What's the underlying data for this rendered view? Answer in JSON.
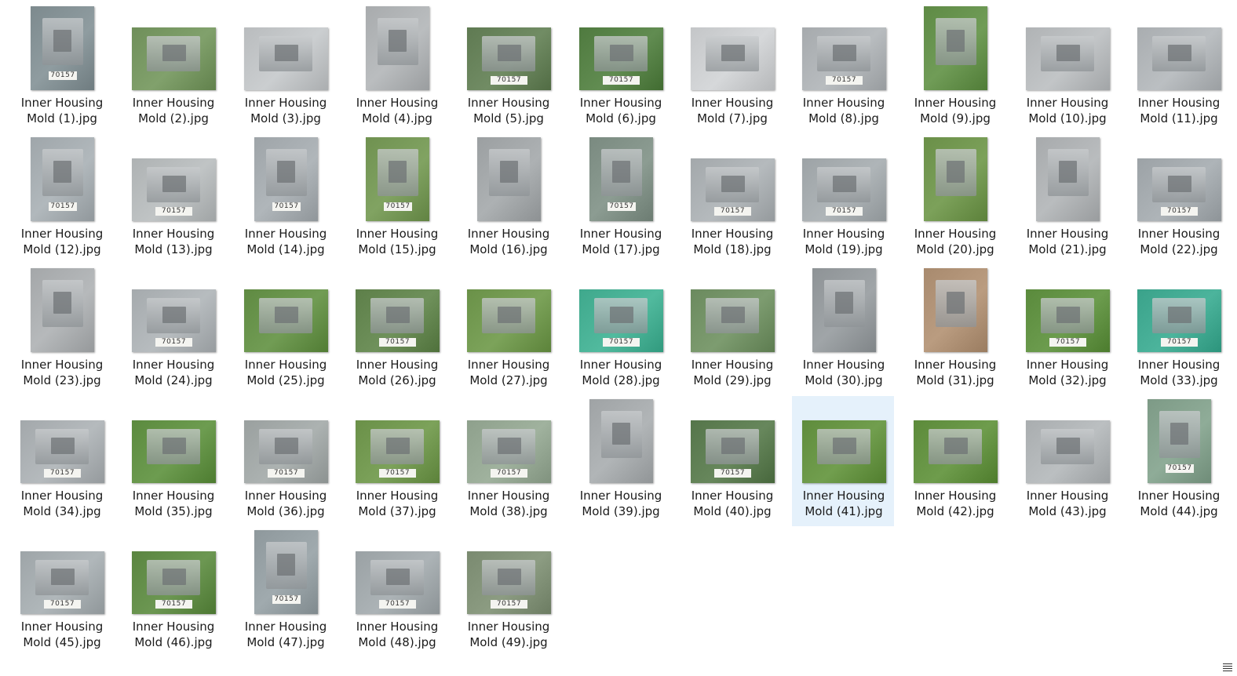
{
  "files": [
    {
      "line1": "Inner Housing",
      "line2": "Mold (1).jpg",
      "kind": "portrait",
      "bg": "#7d8a8e",
      "tag": "70157"
    },
    {
      "line1": "Inner Housing",
      "line2": "Mold (2).jpg",
      "kind": "landscape",
      "bg": "#6f8f5a",
      "tag": ""
    },
    {
      "line1": "Inner Housing",
      "line2": "Mold (3).jpg",
      "kind": "landscape",
      "bg": "#b9bcbe",
      "tag": ""
    },
    {
      "line1": "Inner Housing",
      "line2": "Mold (4).jpg",
      "kind": "portrait",
      "bg": "#a8abad",
      "tag": ""
    },
    {
      "line1": "Inner Housing",
      "line2": "Mold (5).jpg",
      "kind": "landscape",
      "bg": "#5f7a52",
      "tag": "70157"
    },
    {
      "line1": "Inner Housing",
      "line2": "Mold (6).jpg",
      "kind": "landscape",
      "bg": "#4f7a3f",
      "tag": "70157"
    },
    {
      "line1": "Inner Housing",
      "line2": "Mold (7).jpg",
      "kind": "landscape",
      "bg": "#c4c6c8",
      "tag": ""
    },
    {
      "line1": "Inner Housing",
      "line2": "Mold (8).jpg",
      "kind": "landscape",
      "bg": "#a6aaad",
      "tag": "70157"
    },
    {
      "line1": "Inner Housing",
      "line2": "Mold (9).jpg",
      "kind": "portrait",
      "bg": "#5e8a45",
      "tag": ""
    },
    {
      "line1": "Inner Housing",
      "line2": "Mold (10).jpg",
      "kind": "landscape",
      "bg": "#b0b3b5",
      "tag": ""
    },
    {
      "line1": "Inner Housing",
      "line2": "Mold (11).jpg",
      "kind": "landscape",
      "bg": "#a9adb0",
      "tag": ""
    },
    {
      "line1": "Inner Housing",
      "line2": "Mold (12).jpg",
      "kind": "portrait",
      "bg": "#9fa6aa",
      "tag": "70157"
    },
    {
      "line1": "Inner Housing",
      "line2": "Mold (13).jpg",
      "kind": "landscape",
      "bg": "#aeb2b3",
      "tag": "70157"
    },
    {
      "line1": "Inner Housing",
      "line2": "Mold (14).jpg",
      "kind": "portrait",
      "bg": "#9ea4a8",
      "tag": "70157"
    },
    {
      "line1": "Inner Housing",
      "line2": "Mold (15).jpg",
      "kind": "portrait",
      "bg": "#6f9150",
      "tag": "70157"
    },
    {
      "line1": "Inner Housing",
      "line2": "Mold (16).jpg",
      "kind": "portrait",
      "bg": "#9b9fa1",
      "tag": ""
    },
    {
      "line1": "Inner Housing",
      "line2": "Mold (17).jpg",
      "kind": "portrait",
      "bg": "#7a8a80",
      "tag": "70157"
    },
    {
      "line1": "Inner Housing",
      "line2": "Mold (18).jpg",
      "kind": "landscape",
      "bg": "#a3a8ab",
      "tag": "70157"
    },
    {
      "line1": "Inner Housing",
      "line2": "Mold (19).jpg",
      "kind": "landscape",
      "bg": "#9da3a6",
      "tag": "70157"
    },
    {
      "line1": "Inner Housing",
      "line2": "Mold (20).jpg",
      "kind": "portrait",
      "bg": "#6a8f48",
      "tag": ""
    },
    {
      "line1": "Inner Housing",
      "line2": "Mold (21).jpg",
      "kind": "portrait",
      "bg": "#a7aaac",
      "tag": ""
    },
    {
      "line1": "Inner Housing",
      "line2": "Mold (22).jpg",
      "kind": "landscape",
      "bg": "#9ca2a6",
      "tag": "70157"
    },
    {
      "line1": "Inner Housing",
      "line2": "Mold (23).jpg",
      "kind": "portrait",
      "bg": "#a4a7a9",
      "tag": ""
    },
    {
      "line1": "Inner Housing",
      "line2": "Mold (24).jpg",
      "kind": "landscape",
      "bg": "#a5aaad",
      "tag": "70157"
    },
    {
      "line1": "Inner Housing",
      "line2": "Mold (25).jpg",
      "kind": "landscape",
      "bg": "#5f8a42",
      "tag": ""
    },
    {
      "line1": "Inner Housing",
      "line2": "Mold (26).jpg",
      "kind": "landscape",
      "bg": "#5d7f49",
      "tag": "70157"
    },
    {
      "line1": "Inner Housing",
      "line2": "Mold (27).jpg",
      "kind": "landscape",
      "bg": "#6a9148",
      "tag": ""
    },
    {
      "line1": "Inner Housing",
      "line2": "Mold (28).jpg",
      "kind": "landscape",
      "bg": "#3fa88c",
      "tag": "70157"
    },
    {
      "line1": "Inner Housing",
      "line2": "Mold (29).jpg",
      "kind": "landscape",
      "bg": "#6b8a5e",
      "tag": ""
    },
    {
      "line1": "Inner Housing",
      "line2": "Mold (30).jpg",
      "kind": "portrait",
      "bg": "#8e9396",
      "tag": ""
    },
    {
      "line1": "Inner Housing",
      "line2": "Mold (31).jpg",
      "kind": "portrait",
      "bg": "#a88a6e",
      "tag": ""
    },
    {
      "line1": "Inner Housing",
      "line2": "Mold (32).jpg",
      "kind": "landscape",
      "bg": "#5a8a3c",
      "tag": "70157"
    },
    {
      "line1": "Inner Housing",
      "line2": "Mold (33).jpg",
      "kind": "landscape",
      "bg": "#3aa28a",
      "tag": "70157"
    },
    {
      "line1": "Inner Housing",
      "line2": "Mold (34).jpg",
      "kind": "landscape",
      "bg": "#a3a8ab",
      "tag": "70157"
    },
    {
      "line1": "Inner Housing",
      "line2": "Mold (35).jpg",
      "kind": "landscape",
      "bg": "#5b8a3e",
      "tag": ""
    },
    {
      "line1": "Inner Housing",
      "line2": "Mold (36).jpg",
      "kind": "landscape",
      "bg": "#9aa09f",
      "tag": "70157"
    },
    {
      "line1": "Inner Housing",
      "line2": "Mold (37).jpg",
      "kind": "landscape",
      "bg": "#6a9048",
      "tag": "70157"
    },
    {
      "line1": "Inner Housing",
      "line2": "Mold (38).jpg",
      "kind": "landscape",
      "bg": "#8ea08c",
      "tag": "70157"
    },
    {
      "line1": "Inner Housing",
      "line2": "Mold (39).jpg",
      "kind": "portrait",
      "bg": "#9fa3a5",
      "tag": ""
    },
    {
      "line1": "Inner Housing",
      "line2": "Mold (40).jpg",
      "kind": "landscape",
      "bg": "#55754a",
      "tag": "70157"
    },
    {
      "line1": "Inner Housing",
      "line2": "Mold (41).jpg",
      "kind": "landscape",
      "bg": "#5f8c3c",
      "tag": "",
      "selected": true
    },
    {
      "line1": "Inner Housing",
      "line2": "Mold (42).jpg",
      "kind": "landscape",
      "bg": "#5c8a3a",
      "tag": ""
    },
    {
      "line1": "Inner Housing",
      "line2": "Mold (43).jpg",
      "kind": "landscape",
      "bg": "#a9adaf",
      "tag": ""
    },
    {
      "line1": "Inner Housing",
      "line2": "Mold (44).jpg",
      "kind": "portrait",
      "bg": "#7d9a86",
      "tag": "70157"
    },
    {
      "line1": "Inner Housing",
      "line2": "Mold (45).jpg",
      "kind": "landscape",
      "bg": "#9ea5a8",
      "tag": "70157"
    },
    {
      "line1": "Inner Housing",
      "line2": "Mold (46).jpg",
      "kind": "landscape",
      "bg": "#5a8540",
      "tag": "70157"
    },
    {
      "line1": "Inner Housing",
      "line2": "Mold (47).jpg",
      "kind": "portrait",
      "bg": "#8e989c",
      "tag": "70157"
    },
    {
      "line1": "Inner Housing",
      "line2": "Mold (48).jpg",
      "kind": "landscape",
      "bg": "#9aa1a4",
      "tag": "70157"
    },
    {
      "line1": "Inner Housing",
      "line2": "Mold (49).jpg",
      "kind": "landscape",
      "bg": "#7a8a70",
      "tag": "70157"
    }
  ],
  "icons": {
    "view_menu": "hamburger-menu-icon"
  },
  "colors": {
    "selection": "#e5f1fb",
    "text": "#1a1a1a"
  }
}
